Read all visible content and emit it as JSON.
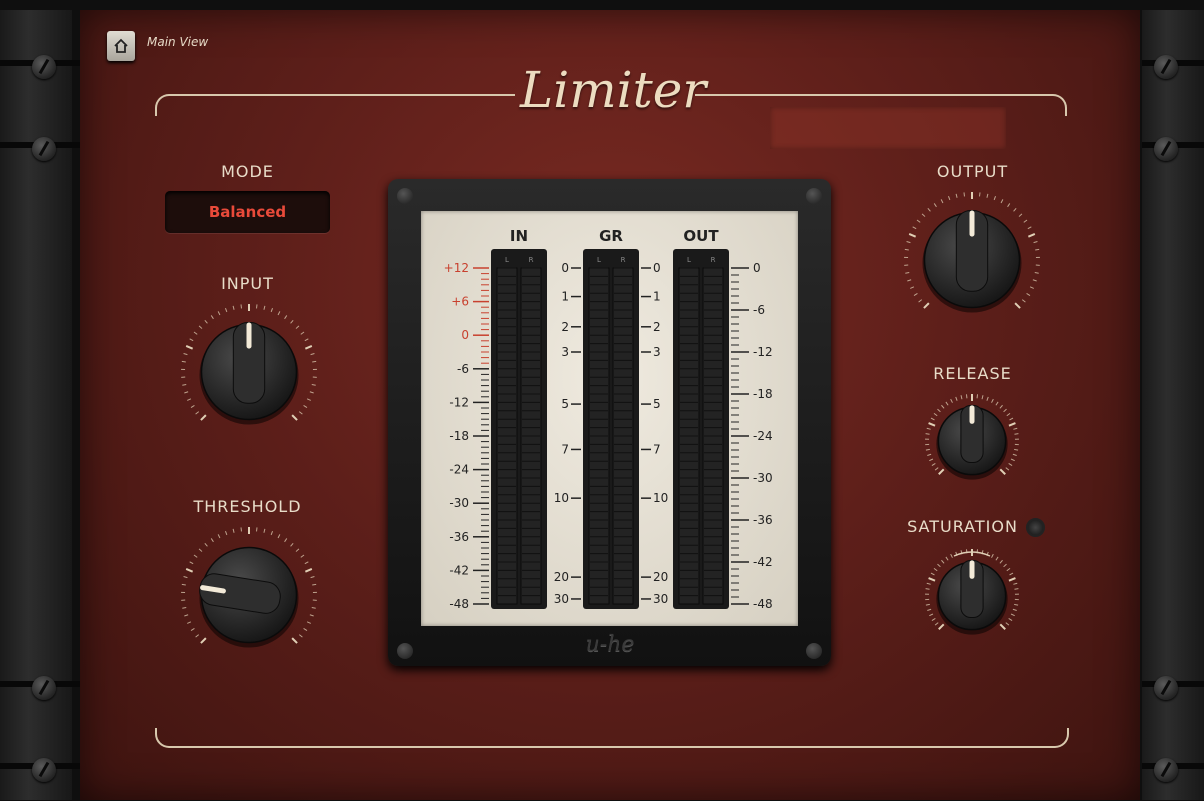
{
  "header": {
    "home_icon": "home-icon",
    "view_label": "Main View",
    "plugin_name": "Limiter",
    "preset_name": ""
  },
  "mode": {
    "label": "MODE",
    "value": "Balanced"
  },
  "knobs": {
    "input": {
      "label": "INPUT",
      "value": 0.5
    },
    "threshold": {
      "label": "THRESHOLD",
      "value": 0.2
    },
    "output": {
      "label": "OUTPUT",
      "value": 0.5
    },
    "release": {
      "label": "RELEASE",
      "value": 0.5
    },
    "saturation": {
      "label": "SATURATION",
      "value": 0.5
    }
  },
  "meter": {
    "brand": "u-he",
    "columns": [
      {
        "title": "IN",
        "channels": [
          "L",
          "R"
        ]
      },
      {
        "title": "GR",
        "channels": [
          "L",
          "R"
        ]
      },
      {
        "title": "OUT",
        "channels": [
          "L",
          "R"
        ]
      }
    ],
    "in_scale": [
      {
        "text": "+12",
        "red": true
      },
      {
        "text": "+6",
        "red": true
      },
      {
        "text": "0",
        "red": true
      },
      {
        "text": "-6",
        "red": false
      },
      {
        "text": "-12",
        "red": false
      },
      {
        "text": "-18",
        "red": false
      },
      {
        "text": "-24",
        "red": false
      },
      {
        "text": "-30",
        "red": false
      },
      {
        "text": "-36",
        "red": false
      },
      {
        "text": "-42",
        "red": false
      },
      {
        "text": "-48",
        "red": false
      }
    ],
    "gr_scale": [
      "0",
      "1",
      "2",
      "3",
      "5",
      "7",
      "10",
      "20",
      "30"
    ],
    "out_scale": [
      "0",
      "-6",
      "-12",
      "-18",
      "-24",
      "-30",
      "-36",
      "-42",
      "-48"
    ]
  },
  "colors": {
    "panel": "#6a241d",
    "mode_text": "#e94a3a",
    "label_text": "#e8dcc8",
    "frame_line": "#d8c8ad"
  }
}
